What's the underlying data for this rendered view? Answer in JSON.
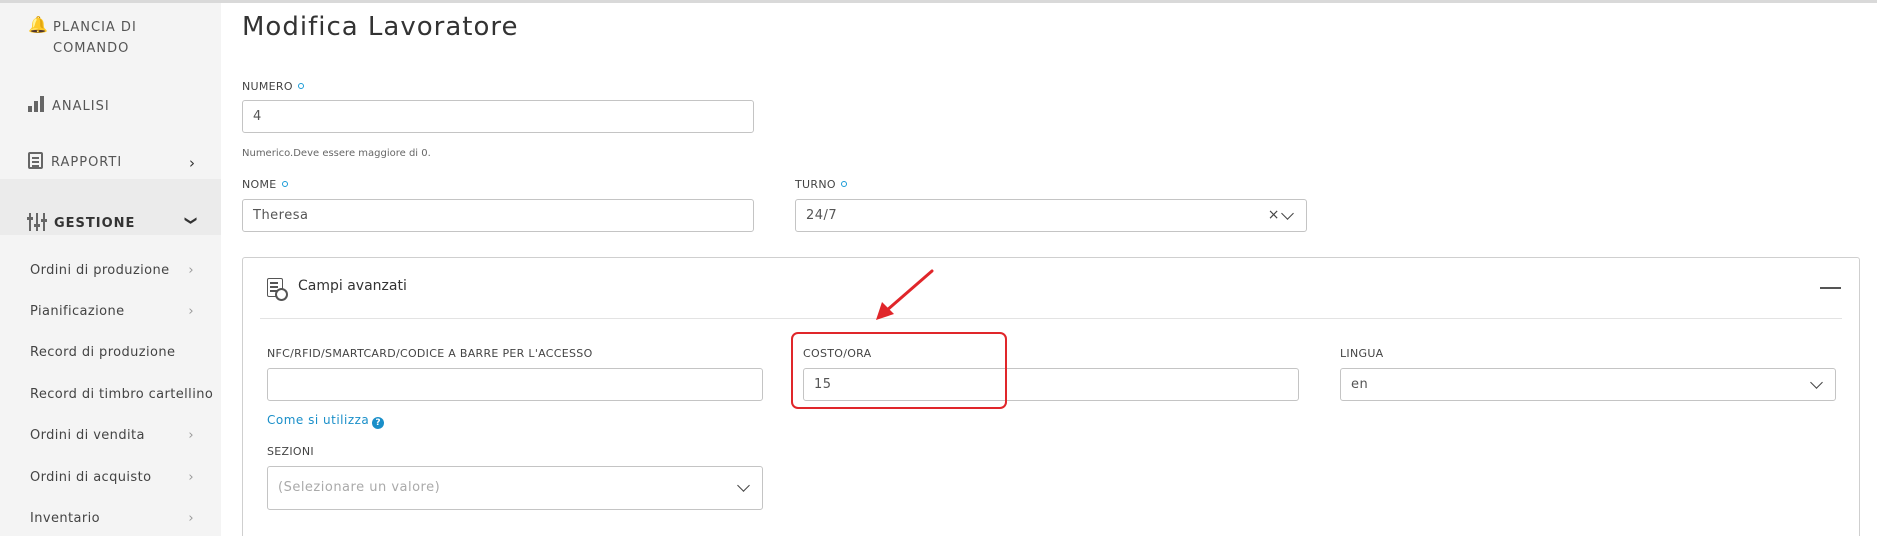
{
  "sidebar": {
    "dashboard": "PLANCIA DI COMANDO",
    "analisi": "ANALISI",
    "rapporti": "RAPPORTI",
    "gestione": "GESTIONE",
    "items": [
      {
        "label": "Ordini di produzione",
        "has_arrow": true
      },
      {
        "label": "Pianificazione",
        "has_arrow": true
      },
      {
        "label": "Record di produzione",
        "has_arrow": false
      },
      {
        "label": "Record di timbro cartellino",
        "has_arrow": false
      },
      {
        "label": "Ordini di vendita",
        "has_arrow": true
      },
      {
        "label": "Ordini di acquisto",
        "has_arrow": true
      },
      {
        "label": "Inventario",
        "has_arrow": true
      }
    ]
  },
  "page": {
    "title": "Modifica Lavoratore"
  },
  "form": {
    "numero": {
      "label": "NUMERO",
      "value": "4",
      "hint": "Numerico.Deve essere maggiore di 0."
    },
    "nome": {
      "label": "NOME",
      "value": "Theresa"
    },
    "turno": {
      "label": "TURNO",
      "value": "24/7"
    }
  },
  "advanced": {
    "title": "Campi avanzati",
    "nfc": {
      "label": "NFC/RFID/SMARTCARD/CODICE A BARRE PER L'ACCESSO",
      "value": ""
    },
    "how_to": "Come si utilizza",
    "costo": {
      "label": "COSTO/ORA",
      "value": "15"
    },
    "lingua": {
      "label": "LINGUA",
      "value": "en"
    },
    "sezioni": {
      "label": "SEZIONI",
      "placeholder": "(Selezionare un valore)"
    }
  },
  "colors": {
    "accent": "#1a8fc9",
    "highlight": "#e0262a"
  }
}
